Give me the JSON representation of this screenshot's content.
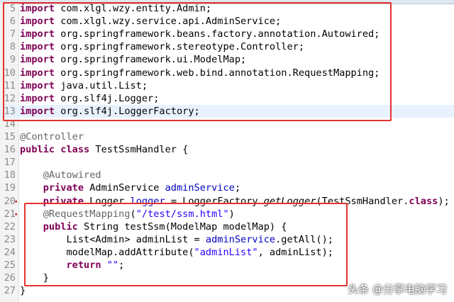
{
  "editor": {
    "lines": [
      {
        "num": "5",
        "parts": [
          {
            "t": "import",
            "c": "kw"
          },
          {
            "t": " com.xlgl.wzy.entity.Admin;"
          }
        ]
      },
      {
        "num": "6",
        "parts": [
          {
            "t": "import",
            "c": "kw"
          },
          {
            "t": " com.xlgl.wzy.service.api.AdminService;"
          }
        ]
      },
      {
        "num": "7",
        "parts": [
          {
            "t": "import",
            "c": "kw"
          },
          {
            "t": " org.springframework.beans.factory.annotation.Autowired;"
          }
        ]
      },
      {
        "num": "8",
        "parts": [
          {
            "t": "import",
            "c": "kw"
          },
          {
            "t": " org.springframework.stereotype.Controller;"
          }
        ]
      },
      {
        "num": "9",
        "parts": [
          {
            "t": "import",
            "c": "kw"
          },
          {
            "t": " org.springframework.ui.ModelMap;"
          }
        ]
      },
      {
        "num": "10",
        "parts": [
          {
            "t": "import",
            "c": "kw"
          },
          {
            "t": " org.springframework.web.bind.annotation.RequestMapping;"
          }
        ]
      },
      {
        "num": "11",
        "parts": [
          {
            "t": "import",
            "c": "kw"
          },
          {
            "t": " java.util.List;"
          }
        ]
      },
      {
        "num": "12",
        "parts": [
          {
            "t": "import",
            "c": "kw"
          },
          {
            "t": " org.slf4j.Logger;"
          }
        ]
      },
      {
        "num": "13",
        "parts": [
          {
            "t": "import",
            "c": "kw"
          },
          {
            "t": " org.slf4j.LoggerFactory;"
          }
        ],
        "cursor": true
      },
      {
        "num": "14",
        "parts": []
      },
      {
        "num": "15",
        "parts": [
          {
            "t": "@Controller",
            "c": "ann"
          }
        ]
      },
      {
        "num": "16",
        "parts": [
          {
            "t": "public",
            "c": "kw"
          },
          {
            "t": " "
          },
          {
            "t": "class",
            "c": "kw"
          },
          {
            "t": " TestSsmHandler {"
          }
        ]
      },
      {
        "num": "17",
        "parts": []
      },
      {
        "num": "18",
        "parts": [
          {
            "t": "    "
          },
          {
            "t": "@Autowired",
            "c": "ann"
          }
        ]
      },
      {
        "num": "19",
        "parts": [
          {
            "t": "    "
          },
          {
            "t": "private",
            "c": "kw"
          },
          {
            "t": " AdminService "
          },
          {
            "t": "adminService",
            "c": "fld"
          },
          {
            "t": ";"
          }
        ]
      },
      {
        "num": "20",
        "parts": [
          {
            "t": "    "
          },
          {
            "t": "private",
            "c": "kw"
          },
          {
            "t": " Logger "
          },
          {
            "t": "logger",
            "c": "fld"
          },
          {
            "t": " = LoggerFactory."
          },
          {
            "t": "getLogger",
            "c": "it"
          },
          {
            "t": "(TestSsmHandler."
          },
          {
            "t": "class",
            "c": "kw"
          },
          {
            "t": ");"
          }
        ]
      },
      {
        "num": "21",
        "parts": [
          {
            "t": "    "
          },
          {
            "t": "@RequestMapping",
            "c": "ann"
          },
          {
            "t": "("
          },
          {
            "t": "\"/test/ssm.html\"",
            "c": "str"
          },
          {
            "t": ")"
          }
        ]
      },
      {
        "num": "22",
        "parts": [
          {
            "t": "    "
          },
          {
            "t": "public",
            "c": "kw"
          },
          {
            "t": " String testSsm(ModelMap modelMap) {"
          }
        ]
      },
      {
        "num": "23",
        "parts": [
          {
            "t": "        List<Admin> adminList = "
          },
          {
            "t": "adminService",
            "c": "fld"
          },
          {
            "t": ".getAll();"
          }
        ]
      },
      {
        "num": "24",
        "parts": [
          {
            "t": "        modelMap.addAttribute("
          },
          {
            "t": "\"adminList\"",
            "c": "str"
          },
          {
            "t": ", adminList);"
          }
        ]
      },
      {
        "num": "25",
        "parts": [
          {
            "t": "        "
          },
          {
            "t": "return",
            "c": "kw"
          },
          {
            "t": " "
          },
          {
            "t": "\"\"",
            "c": "str"
          },
          {
            "t": ";"
          }
        ]
      },
      {
        "num": "26",
        "parts": [
          {
            "t": "    }"
          }
        ]
      },
      {
        "num": "27",
        "parts": [
          {
            "t": "}"
          }
        ]
      }
    ]
  },
  "watermark": {
    "text": "头条 @分享电脑学习"
  },
  "colors": {
    "keyword": "#7f0055",
    "annotation": "#646464",
    "string": "#2a00ff",
    "field": "#0000c0",
    "highlight_box": "#e4322f"
  }
}
